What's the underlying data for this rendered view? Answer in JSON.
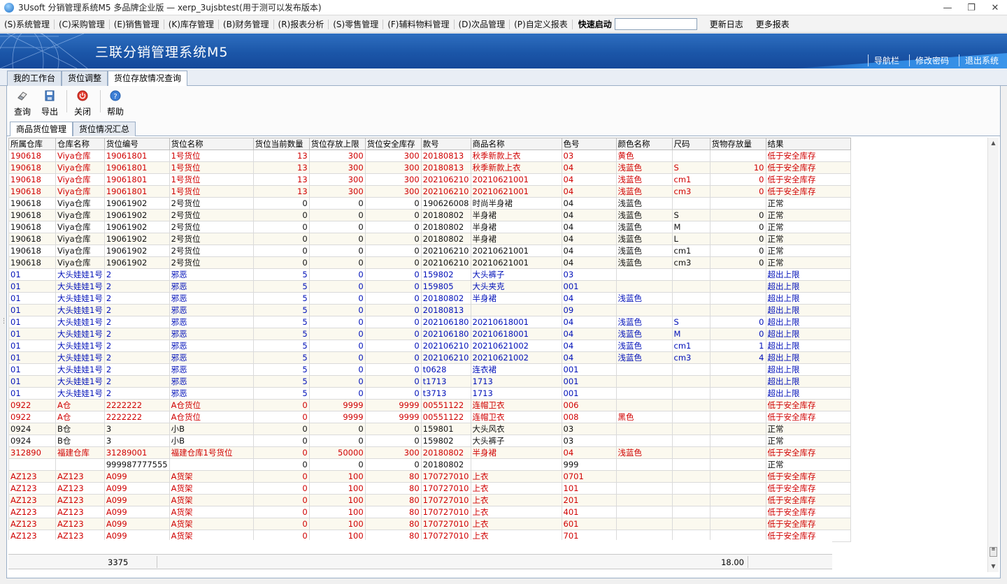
{
  "window": {
    "title": "3Usoft 分销管理系统M5 多品牌企业版 — xerp_3ujsbtest(用于测可以发布版本)",
    "controls": {
      "minimize": "—",
      "restore": "❐",
      "close": "✕"
    }
  },
  "menu": {
    "items": [
      "(S)系统管理",
      "(C)采购管理",
      "(E)销售管理",
      "(K)库存管理",
      "(B)财务管理",
      "(R)报表分析",
      "(S)零售管理",
      "(F)辅料物料管理",
      "(D)次品管理",
      "(P)自定义报表"
    ],
    "quick_start_label": "快速启动",
    "quick_start_value": "",
    "changelog": "更新日志",
    "more_reports": "更多报表"
  },
  "banner": {
    "title": "三联分销管理系统M5",
    "links": [
      "导航栏",
      "修改密码",
      "退出系统"
    ]
  },
  "main_tabs": [
    "我的工作台",
    "货位调整",
    "货位存放情况查询"
  ],
  "toolbar": {
    "query": "查询",
    "export": "导出",
    "close": "关闭",
    "help": "帮助"
  },
  "sub_tabs": [
    "商品货位管理",
    "货位情况汇总"
  ],
  "colors": {
    "red_row": "#d00000",
    "blue_row": "#0010b8",
    "banner": "#1b56a8"
  },
  "table": {
    "columns": [
      "所属仓库",
      "仓库名称",
      "货位编号",
      "货位名称",
      "货位当前数量",
      "货位存放上限",
      "货位安全库存",
      "款号",
      "商品名称",
      "色号",
      "颜色名称",
      "尺码",
      "货物存放量",
      "结果"
    ],
    "rows": [
      {
        "c": "red",
        "v": [
          "190618",
          "Viya仓库",
          "19061801",
          "1号货位",
          "13",
          "300",
          "300",
          "20180813",
          "秋季新款上衣",
          "03",
          "黄色",
          "",
          "",
          "低于安全库存"
        ]
      },
      {
        "c": "red",
        "v": [
          "190618",
          "Viya仓库",
          "19061801",
          "1号货位",
          "13",
          "300",
          "300",
          "20180813",
          "秋季新款上衣",
          "04",
          "浅蓝色",
          "S",
          "10",
          "低于安全库存"
        ]
      },
      {
        "c": "red",
        "v": [
          "190618",
          "Viya仓库",
          "19061801",
          "1号货位",
          "13",
          "300",
          "300",
          "202106210",
          "20210621001",
          "04",
          "浅蓝色",
          "cm1",
          "0",
          "低于安全库存"
        ]
      },
      {
        "c": "red",
        "v": [
          "190618",
          "Viya仓库",
          "19061801",
          "1号货位",
          "13",
          "300",
          "300",
          "202106210",
          "20210621001",
          "04",
          "浅蓝色",
          "cm3",
          "0",
          "低于安全库存"
        ]
      },
      {
        "c": "black",
        "v": [
          "190618",
          "Viya仓库",
          "19061902",
          "2号货位",
          "0",
          "0",
          "0",
          "190626008",
          "时尚半身裙",
          "04",
          "浅蓝色",
          "",
          "",
          "正常"
        ]
      },
      {
        "c": "black",
        "v": [
          "190618",
          "Viya仓库",
          "19061902",
          "2号货位",
          "0",
          "0",
          "0",
          "20180802",
          "半身裙",
          "04",
          "浅蓝色",
          "S",
          "0",
          "正常"
        ]
      },
      {
        "c": "black",
        "v": [
          "190618",
          "Viya仓库",
          "19061902",
          "2号货位",
          "0",
          "0",
          "0",
          "20180802",
          "半身裙",
          "04",
          "浅蓝色",
          "M",
          "0",
          "正常"
        ]
      },
      {
        "c": "black",
        "v": [
          "190618",
          "Viya仓库",
          "19061902",
          "2号货位",
          "0",
          "0",
          "0",
          "20180802",
          "半身裙",
          "04",
          "浅蓝色",
          "L",
          "0",
          "正常"
        ]
      },
      {
        "c": "black",
        "v": [
          "190618",
          "Viya仓库",
          "19061902",
          "2号货位",
          "0",
          "0",
          "0",
          "202106210",
          "20210621001",
          "04",
          "浅蓝色",
          "cm1",
          "0",
          "正常"
        ]
      },
      {
        "c": "black",
        "v": [
          "190618",
          "Viya仓库",
          "19061902",
          "2号货位",
          "0",
          "0",
          "0",
          "202106210",
          "20210621001",
          "04",
          "浅蓝色",
          "cm3",
          "0",
          "正常"
        ]
      },
      {
        "c": "blue",
        "v": [
          "01",
          "大头娃娃1号",
          "2",
          "邪恶",
          "5",
          "0",
          "0",
          "159802",
          "大头裤子",
          "03",
          "",
          "",
          "",
          "超出上限"
        ]
      },
      {
        "c": "blue",
        "v": [
          "01",
          "大头娃娃1号",
          "2",
          "邪恶",
          "5",
          "0",
          "0",
          "159805",
          "大头夹克",
          "001",
          "",
          "",
          "",
          "超出上限"
        ]
      },
      {
        "c": "blue",
        "v": [
          "01",
          "大头娃娃1号",
          "2",
          "邪恶",
          "5",
          "0",
          "0",
          "20180802",
          "半身裙",
          "04",
          "浅蓝色",
          "",
          "",
          "超出上限"
        ]
      },
      {
        "c": "blue",
        "v": [
          "01",
          "大头娃娃1号",
          "2",
          "邪恶",
          "5",
          "0",
          "0",
          "20180813",
          "",
          "09",
          "",
          "",
          "",
          "超出上限"
        ]
      },
      {
        "c": "blue",
        "v": [
          "01",
          "大头娃娃1号",
          "2",
          "邪恶",
          "5",
          "0",
          "0",
          "202106180",
          "20210618001",
          "04",
          "浅蓝色",
          "S",
          "0",
          "超出上限"
        ]
      },
      {
        "c": "blue",
        "v": [
          "01",
          "大头娃娃1号",
          "2",
          "邪恶",
          "5",
          "0",
          "0",
          "202106180",
          "20210618001",
          "04",
          "浅蓝色",
          "M",
          "0",
          "超出上限"
        ]
      },
      {
        "c": "blue",
        "v": [
          "01",
          "大头娃娃1号",
          "2",
          "邪恶",
          "5",
          "0",
          "0",
          "202106210",
          "20210621002",
          "04",
          "浅蓝色",
          "cm1",
          "1",
          "超出上限"
        ]
      },
      {
        "c": "blue",
        "v": [
          "01",
          "大头娃娃1号",
          "2",
          "邪恶",
          "5",
          "0",
          "0",
          "202106210",
          "20210621002",
          "04",
          "浅蓝色",
          "cm3",
          "4",
          "超出上限"
        ]
      },
      {
        "c": "blue",
        "v": [
          "01",
          "大头娃娃1号",
          "2",
          "邪恶",
          "5",
          "0",
          "0",
          "t0628",
          "连衣裙",
          "001",
          "",
          "",
          "",
          "超出上限"
        ]
      },
      {
        "c": "blue",
        "v": [
          "01",
          "大头娃娃1号",
          "2",
          "邪恶",
          "5",
          "0",
          "0",
          "t1713",
          "1713",
          "001",
          "",
          "",
          "",
          "超出上限"
        ]
      },
      {
        "c": "blue",
        "v": [
          "01",
          "大头娃娃1号",
          "2",
          "邪恶",
          "5",
          "0",
          "0",
          "t3713",
          "1713",
          "001",
          "",
          "",
          "",
          "超出上限"
        ]
      },
      {
        "c": "red",
        "v": [
          "0922",
          "A仓",
          "2222222",
          "A仓货位",
          "0",
          "9999",
          "9999",
          "00551122",
          "连帽卫衣",
          "006",
          "",
          "",
          "",
          "低于安全库存"
        ]
      },
      {
        "c": "red",
        "v": [
          "0922",
          "A仓",
          "2222222",
          "A仓货位",
          "0",
          "9999",
          "9999",
          "00551122",
          "连帽卫衣",
          "008",
          "黑色",
          "",
          "",
          "低于安全库存"
        ]
      },
      {
        "c": "black",
        "v": [
          "0924",
          "B仓",
          "3",
          "小B",
          "0",
          "0",
          "0",
          "159801",
          "大头风衣",
          "03",
          "",
          "",
          "",
          "正常"
        ]
      },
      {
        "c": "black",
        "v": [
          "0924",
          "B仓",
          "3",
          "小B",
          "0",
          "0",
          "0",
          "159802",
          "大头裤子",
          "03",
          "",
          "",
          "",
          "正常"
        ]
      },
      {
        "c": "red",
        "v": [
          "312890",
          "福建仓库",
          "31289001",
          "福建仓库1号货位",
          "0",
          "50000",
          "300",
          "20180802",
          "半身裙",
          "04",
          "浅蓝色",
          "",
          "",
          "低于安全库存"
        ]
      },
      {
        "c": "black",
        "v": [
          "",
          "",
          "999987777555",
          "",
          "0",
          "0",
          "0",
          "20180802",
          "",
          "999",
          "",
          "",
          "",
          "正常"
        ]
      },
      {
        "c": "red",
        "v": [
          "AZ123",
          "AZ123",
          "A099",
          "A货架",
          "0",
          "100",
          "80",
          "170727010",
          "上衣",
          "0701",
          "",
          "",
          "",
          "低于安全库存"
        ]
      },
      {
        "c": "red",
        "v": [
          "AZ123",
          "AZ123",
          "A099",
          "A货架",
          "0",
          "100",
          "80",
          "170727010",
          "上衣",
          "101",
          "",
          "",
          "",
          "低于安全库存"
        ]
      },
      {
        "c": "red",
        "v": [
          "AZ123",
          "AZ123",
          "A099",
          "A货架",
          "0",
          "100",
          "80",
          "170727010",
          "上衣",
          "201",
          "",
          "",
          "",
          "低于安全库存"
        ]
      },
      {
        "c": "red",
        "v": [
          "AZ123",
          "AZ123",
          "A099",
          "A货架",
          "0",
          "100",
          "80",
          "170727010",
          "上衣",
          "401",
          "",
          "",
          "",
          "低于安全库存"
        ]
      },
      {
        "c": "red",
        "v": [
          "AZ123",
          "AZ123",
          "A099",
          "A货架",
          "0",
          "100",
          "80",
          "170727010",
          "上衣",
          "601",
          "",
          "",
          "",
          "低于安全库存"
        ]
      },
      {
        "c": "red",
        "v": [
          "AZ123",
          "AZ123",
          "A099",
          "A货架",
          "0",
          "100",
          "80",
          "170727010",
          "上衣",
          "701",
          "",
          "",
          "",
          "低于安全库存"
        ]
      }
    ]
  },
  "footer": {
    "count": "3375",
    "total": "18.00"
  }
}
